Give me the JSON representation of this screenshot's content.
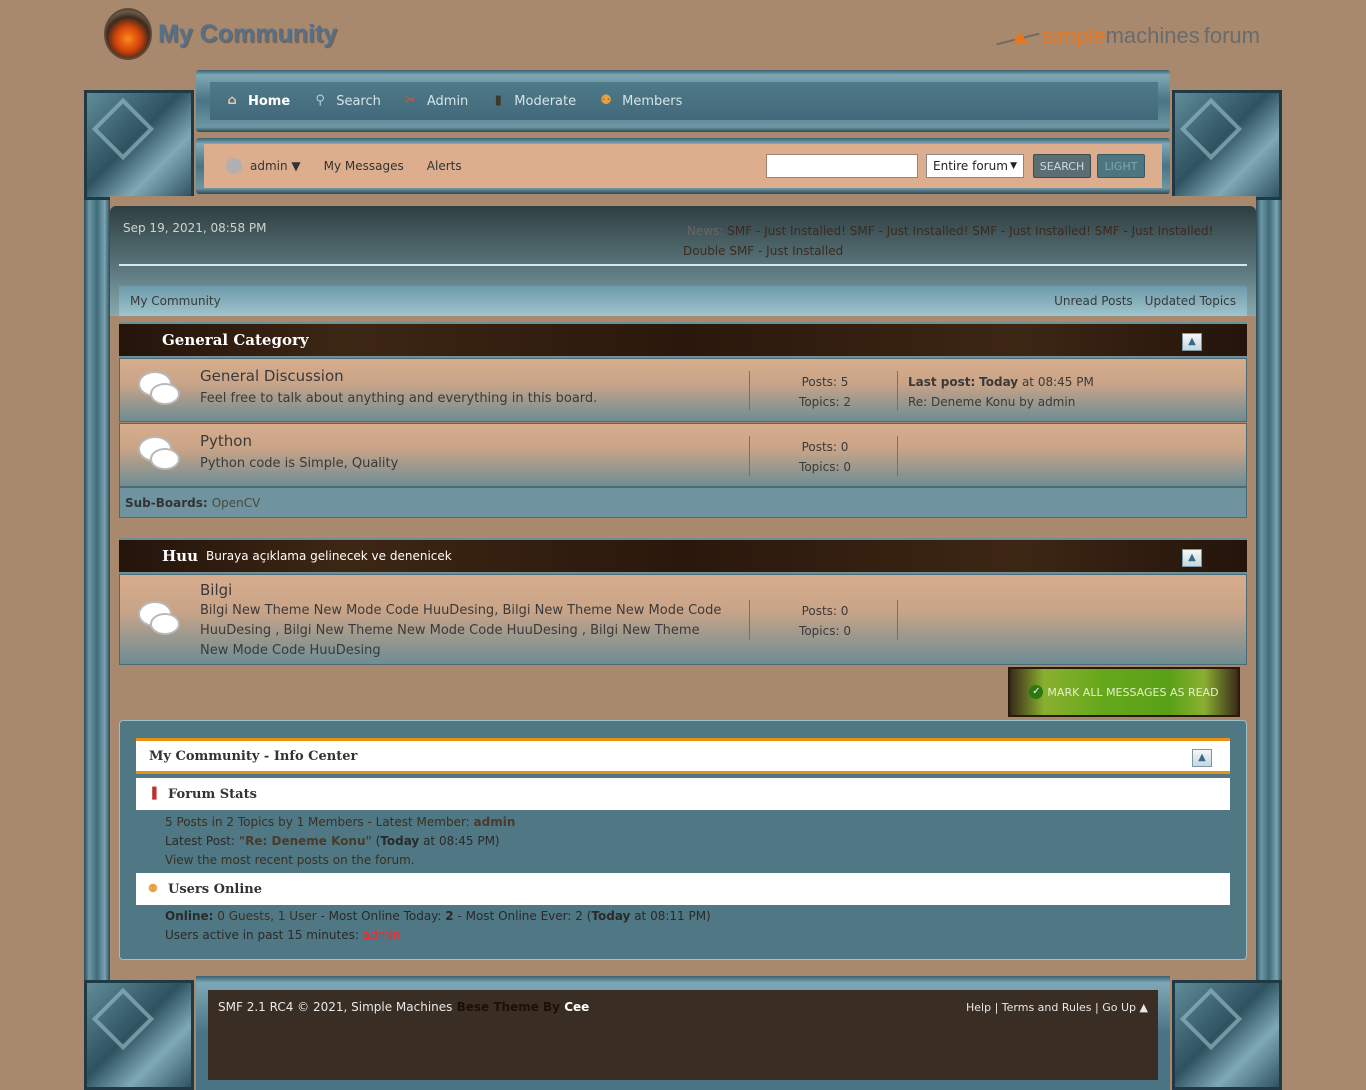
{
  "header": {
    "forum_name": "My Community",
    "brand_simple": "simple",
    "brand_machines": "machines",
    "brand_forum": "forum"
  },
  "nav": [
    {
      "label": "Home",
      "icon": "home-icon",
      "glyph": "⌂"
    },
    {
      "label": "Search",
      "icon": "search-icon",
      "glyph": "⚲"
    },
    {
      "label": "Admin",
      "icon": "admin-icon",
      "glyph": "✂"
    },
    {
      "label": "Moderate",
      "icon": "moderate-icon",
      "glyph": "▮"
    },
    {
      "label": "Members",
      "icon": "members-icon",
      "glyph": "⚉"
    }
  ],
  "userbar": {
    "username": "admin ▼",
    "messages": "My Messages",
    "alerts": "Alerts"
  },
  "search": {
    "value": "",
    "scope": "Entire forum",
    "button": "SEARCH",
    "light": "LIGHT"
  },
  "top": {
    "date": "Sep 19, 2021, 08:58 PM",
    "news_label": "News:",
    "news_text": "SMF - Just Installed! SMF - Just Installed! SMF - Just Installed! SMF - Just Installed! Double SMF - Just Installed"
  },
  "breadcrumb": {
    "home": "My Community",
    "unread": "Unread Posts",
    "updated": "Updated Topics"
  },
  "categories": [
    {
      "title": "General Category",
      "desc": "",
      "boards": [
        {
          "name": "General Discussion",
          "desc": "Feel free to talk about anything and everything in this board.",
          "posts": "Posts: 5",
          "topics": "Topics: 2",
          "last_label": "Last post:",
          "last_when": "Today",
          "last_time": " at 08:45 PM",
          "last_topic": "Re: Deneme Konu by admin"
        },
        {
          "name": "Python",
          "desc": "Python code is Simple, Quality",
          "posts": "Posts: 0",
          "topics": "Topics: 0"
        }
      ],
      "subboards_label": "Sub-Boards:",
      "subboards": "OpenCV"
    },
    {
      "title": "Huu",
      "desc": "Buraya açıklama gelinecek ve denenicek",
      "boards": [
        {
          "name": "Bilgi",
          "desc": "Bilgi New Theme New Mode Code HuuDesing, Bilgi New Theme New Mode Code HuuDesing , Bilgi New Theme New Mode Code HuuDesing , Bilgi New Theme New Mode Code HuuDesing",
          "posts": "Posts: 0",
          "topics": "Topics: 0"
        }
      ]
    }
  ],
  "mark_read": "MARK ALL MESSAGES AS READ",
  "info": {
    "title": "My Community - Info Center",
    "stats_title": "Forum Stats",
    "stats_line1": "5 Posts in 2 Topics by 1 Members - Latest Member: ",
    "latest_member": "admin",
    "stats_line2_a": "Latest Post: ",
    "latest_post": "\"Re: Deneme Konu\"",
    "stats_line2_b": " (",
    "stats_today": "Today",
    "stats_line2_c": " at 08:45 PM)",
    "recent_link": "View the most recent posts on the forum.",
    "online_title": "Users Online",
    "online_label": "Online:",
    "online_guests": " 0 Guests, 1 User",
    "online_rest_a": " - Most Online Today: ",
    "online_today": "2",
    "online_rest_b": " -  Most Online Ever: 2 (",
    "online_ever_today": "Today",
    "online_rest_c": " at 08:11 PM)",
    "active_label": "Users active in past 15 minutes: ",
    "active_user": "admin"
  },
  "footer": {
    "copyright": "SMF 2.1 RC4 © 2021, Simple Machines",
    "theme_by": " Bese Theme By ",
    "author": "Cee",
    "help": "Help",
    "terms": "Terms and Rules",
    "goup": "Go Up ▲",
    "sep": " | "
  }
}
